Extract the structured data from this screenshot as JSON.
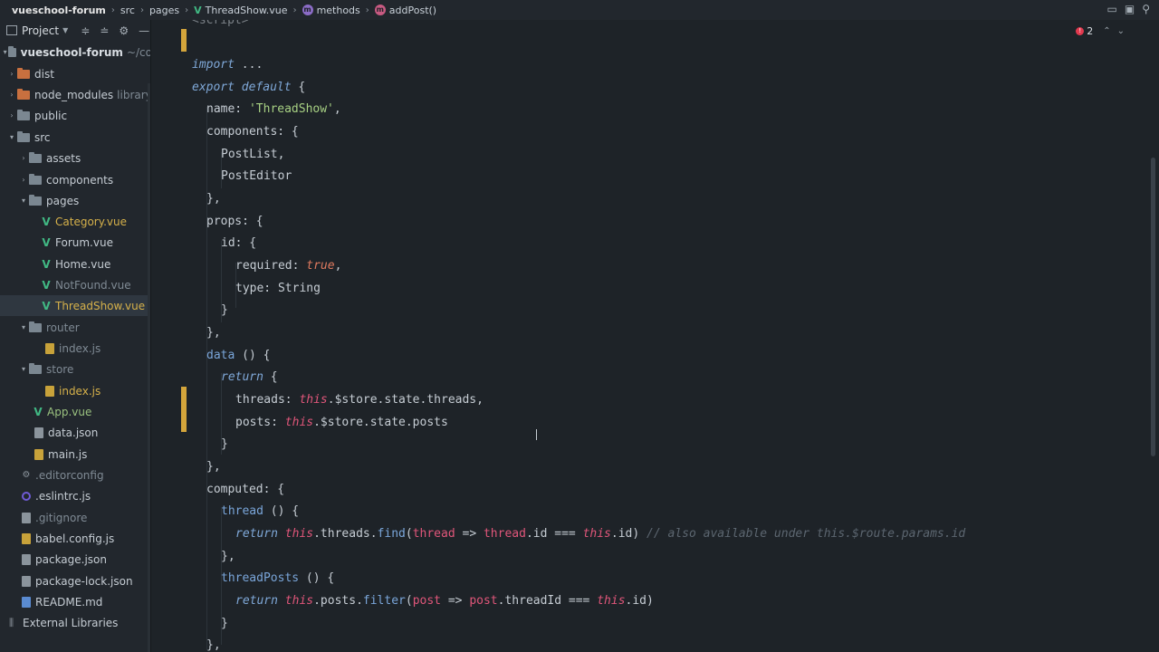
{
  "breadcrumb": {
    "project": "vueschool-forum",
    "path1": "src",
    "path2": "pages",
    "file": "ThreadShow.vue",
    "section": "methods",
    "method": "addPost()"
  },
  "sidebar": {
    "title": "Project",
    "items": [
      {
        "label": "vueschool-forum",
        "hint": "~/co"
      },
      {
        "label": "dist"
      },
      {
        "label": "node_modules",
        "hint": "library"
      },
      {
        "label": "public"
      },
      {
        "label": "src"
      },
      {
        "label": "assets"
      },
      {
        "label": "components"
      },
      {
        "label": "pages"
      },
      {
        "label": "Category.vue"
      },
      {
        "label": "Forum.vue"
      },
      {
        "label": "Home.vue"
      },
      {
        "label": "NotFound.vue"
      },
      {
        "label": "ThreadShow.vue"
      },
      {
        "label": "router"
      },
      {
        "label": "index.js"
      },
      {
        "label": "store"
      },
      {
        "label": "index.js"
      },
      {
        "label": "App.vue"
      },
      {
        "label": "data.json"
      },
      {
        "label": "main.js"
      },
      {
        "label": ".editorconfig"
      },
      {
        "label": ".eslintrc.js"
      },
      {
        "label": ".gitignore"
      },
      {
        "label": "babel.config.js"
      },
      {
        "label": "package.json"
      },
      {
        "label": "package-lock.json"
      },
      {
        "label": "README.md"
      },
      {
        "label": "External Libraries"
      }
    ]
  },
  "editor": {
    "error_count": "2",
    "t": {
      "script": "<script>",
      "import": "import",
      "dots": " ...",
      "export": "export",
      "default": "default",
      "brace_open": " {",
      "name_key": "name: ",
      "name_val": "'ThreadShow'",
      "comma": ",",
      "components": "components: {",
      "postlist": "PostList,",
      "posteditor": "PostEditor",
      "close_comma": "},",
      "props": "props: {",
      "id_obj": "id: {",
      "required": "required: ",
      "true": "true",
      "type": "type: String",
      "close": "}",
      "data": "data",
      "data_paren": " () {",
      "return": "return",
      "threads_key": "threads: ",
      "this": "this",
      "threads_rest": ".$store.state.threads,",
      "posts_key": "posts: ",
      "posts_rest": ".$store.state.posts",
      "computed": "computed: {",
      "thread": "thread",
      "paren_open": " () {",
      "dot_threads": ".threads.",
      "find": "find",
      "find_open": "(",
      "thread_param": "thread",
      "arrow": " => ",
      "thread_id": ".id === ",
      "id_close": ".id) ",
      "comment": "// also available under this.$route.params.id",
      "threadposts": "threadPosts",
      "dot_posts": ".posts.",
      "filter": "filter",
      "post_param": "post",
      "post_tid": ".threadId === ",
      "id_end": ".id)"
    }
  }
}
